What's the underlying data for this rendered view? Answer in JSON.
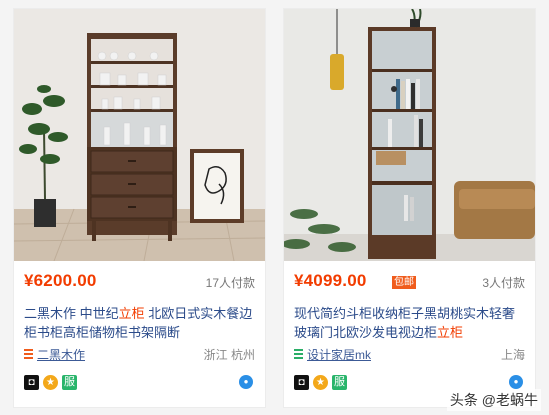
{
  "items": [
    {
      "price": "¥6200.00",
      "free_shipping": "",
      "sales": "17人付款",
      "title_before": "二黑木作 中世纪",
      "title_highlight": "立柜",
      "title_after": " 北欧日式实木餐边柜书柜高柜储物柜书架隔断",
      "shop": "二黑木作",
      "location": "浙江 杭州",
      "shop_icon_color": "#f05c1c",
      "badges": [
        "shield-badge",
        "gold-medal-badge",
        "service-badge"
      ],
      "badge_service_text": "服"
    },
    {
      "price": "¥4099.00",
      "free_shipping": "包邮",
      "sales": "3人付款",
      "title_before": "现代简约斗柜收纳柜子黑胡桃实木轻奢玻璃门北欧沙发电视边柜",
      "title_highlight": "立柜",
      "title_after": "",
      "shop": "设计家居mk",
      "location": "上海",
      "shop_icon_color": "#2aae67",
      "badges": [
        "shield-badge",
        "gold-medal-badge",
        "service-badge"
      ],
      "badge_service_text": "服"
    }
  ],
  "watermark": "头条 @老蜗牛",
  "colors": {
    "price": "#f23c00",
    "title": "#2b4b8a",
    "accent": "#f05c1c"
  }
}
